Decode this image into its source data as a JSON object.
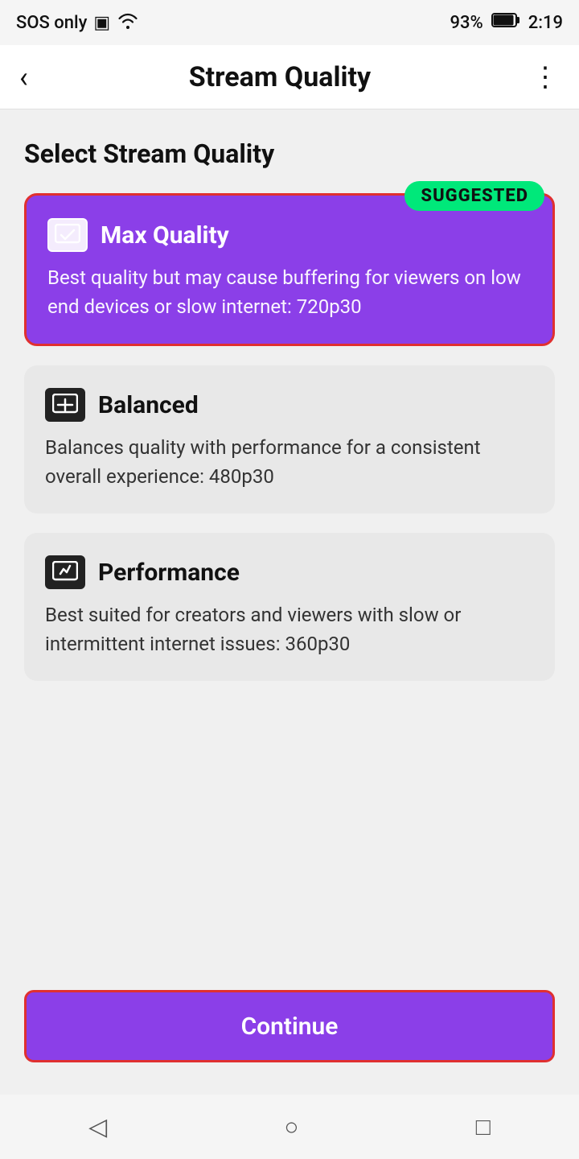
{
  "status": {
    "left": "SOS only",
    "battery": "93%",
    "time": "2:19"
  },
  "nav": {
    "back_icon": "‹",
    "title": "Stream Quality",
    "more_icon": "⋮"
  },
  "page": {
    "section_title": "Select Stream Quality",
    "suggested_label": "SUGGESTED",
    "cards": [
      {
        "id": "max",
        "title": "Max Quality",
        "description": "Best quality but may cause buffering for viewers on low end devices or slow internet: 720p30",
        "selected": true,
        "suggested": true
      },
      {
        "id": "balanced",
        "title": "Balanced",
        "description": "Balances quality with performance for a consistent overall experience: 480p30",
        "selected": false,
        "suggested": false
      },
      {
        "id": "performance",
        "title": "Performance",
        "description": "Best suited for creators and viewers with slow or intermittent internet issues: 360p30",
        "selected": false,
        "suggested": false
      }
    ],
    "continue_label": "Continue"
  },
  "bottom_nav": {
    "back_icon": "◁",
    "home_icon": "○",
    "square_icon": "□"
  }
}
